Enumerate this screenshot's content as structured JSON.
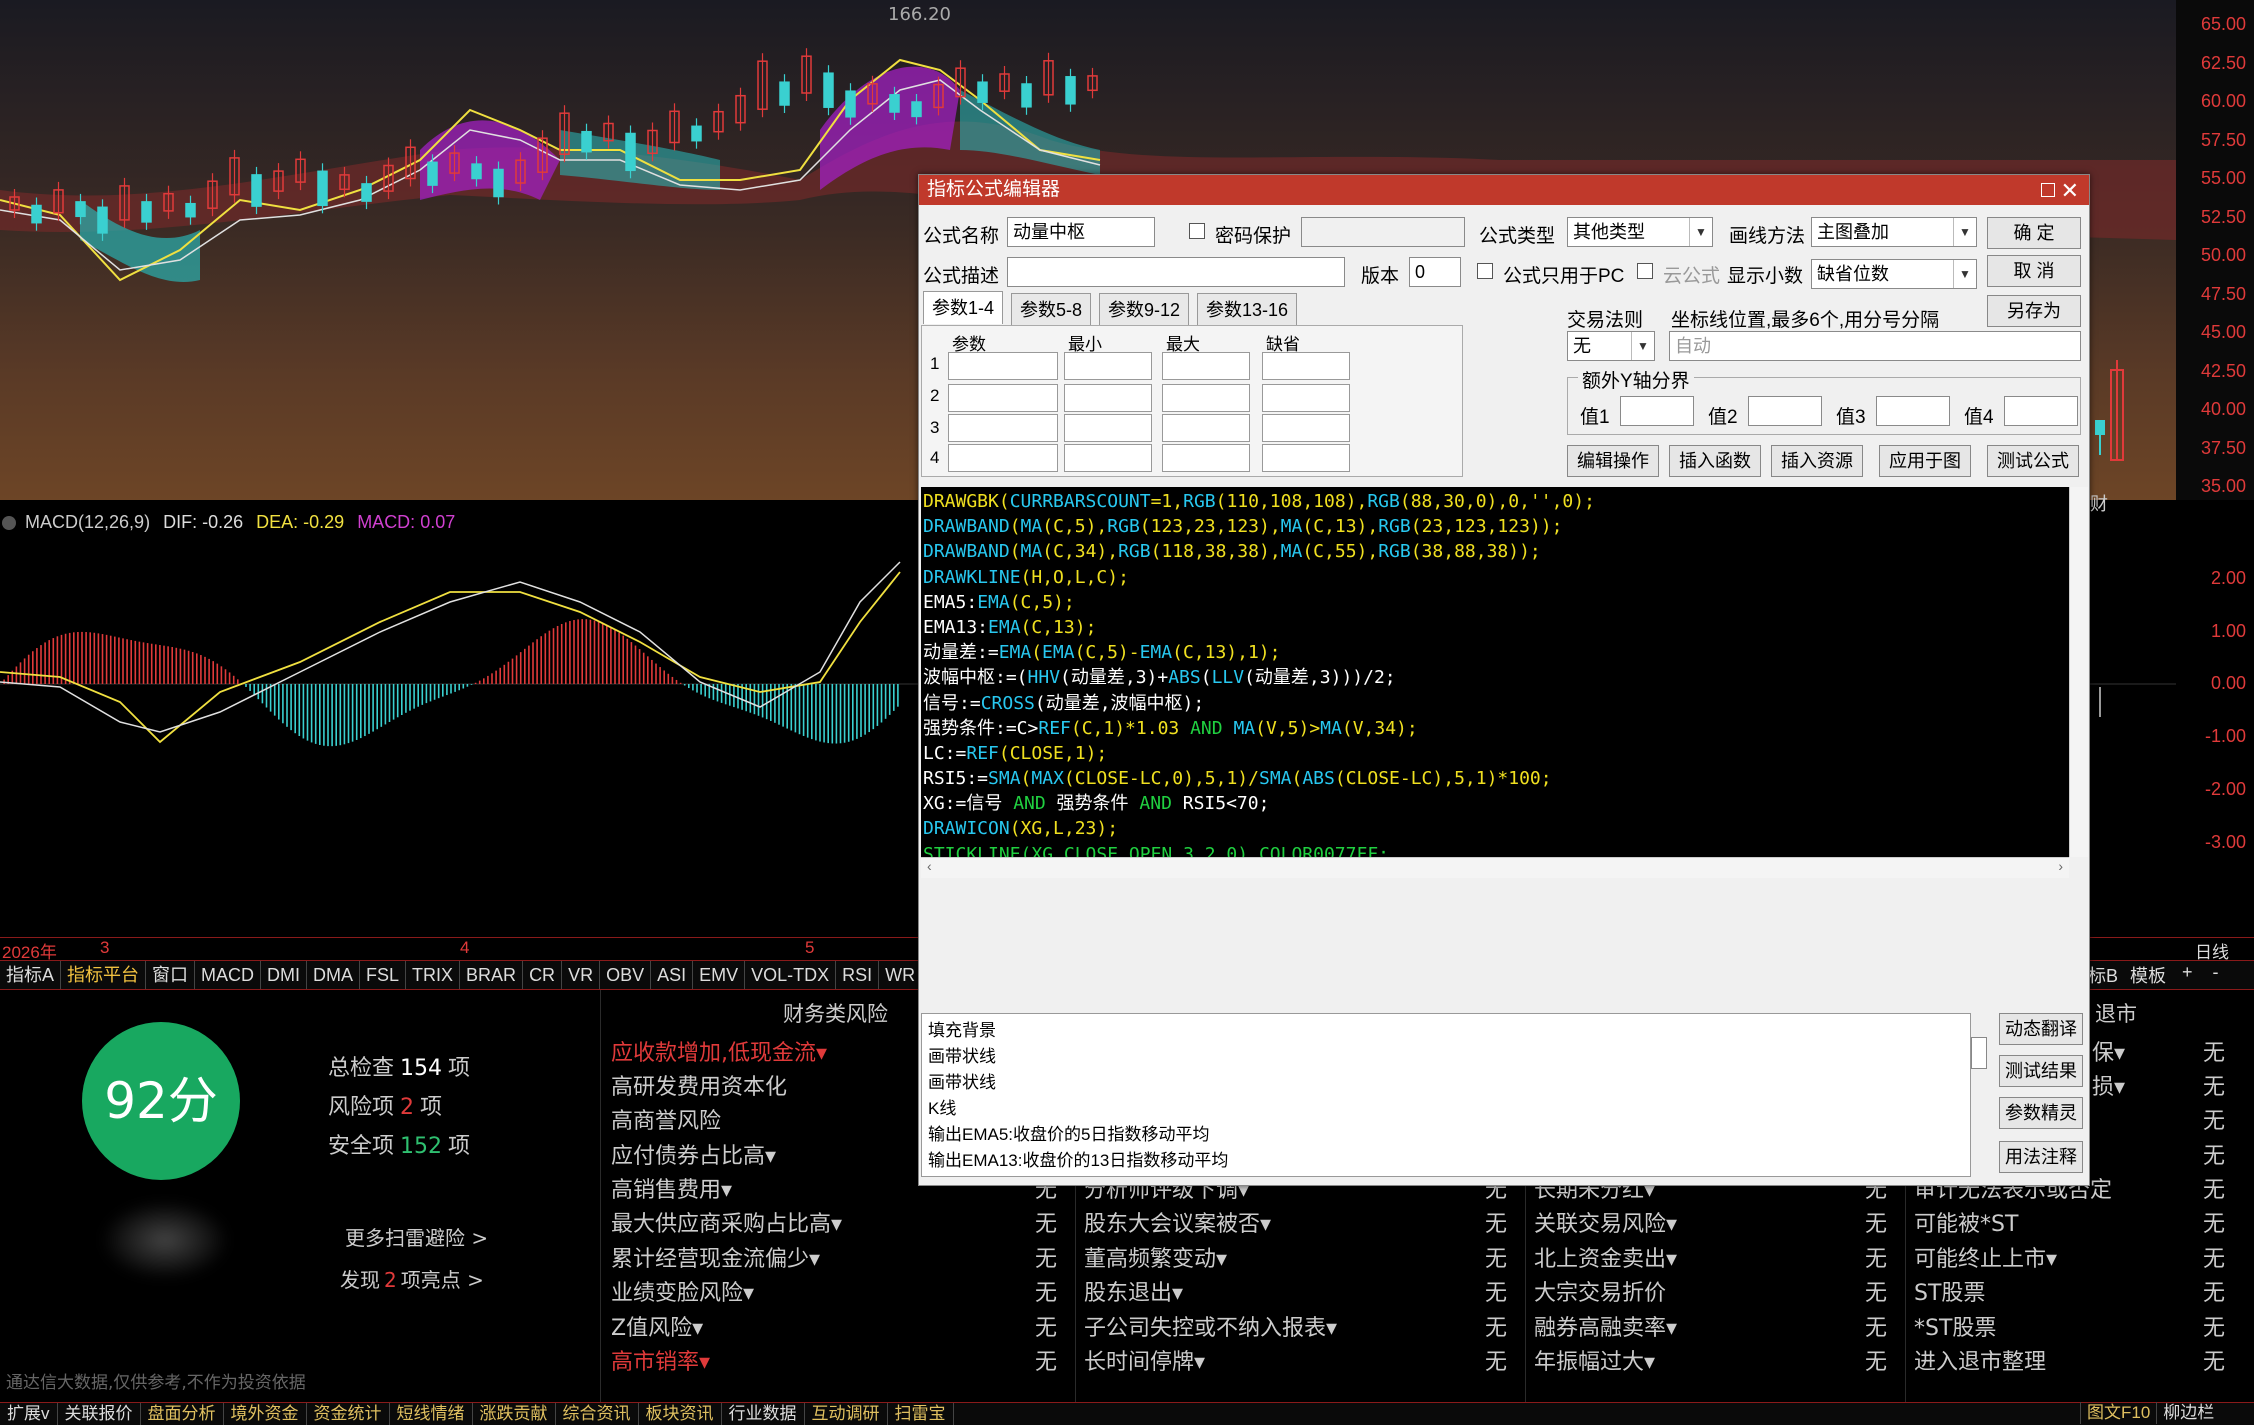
{
  "price_axis": [
    "65.00",
    "62.50",
    "60.00",
    "57.50",
    "55.00",
    "52.50",
    "50.00",
    "47.50",
    "45.00",
    "42.50",
    "40.00",
    "37.50",
    "35.00"
  ],
  "high_marker": "166.20",
  "macd": {
    "label": "MACD(12,26,9)",
    "dif": "DIF: -0.26",
    "dea": "DEA: -0.29",
    "macd": "MACD: 0.07",
    "axis": [
      "2.00",
      "1.00",
      "0.00",
      "-1.00",
      "-2.00",
      "-3.00"
    ],
    "right_label": "财"
  },
  "dates": {
    "year": "2026年",
    "m3": "3",
    "m4": "4",
    "m5": "5",
    "day": "日线"
  },
  "tabs": [
    "指标A",
    "指标平台",
    "窗口",
    "MACD",
    "DMI",
    "DMA",
    "FSL",
    "TRIX",
    "BRAR",
    "CR",
    "VR",
    "OBV",
    "ASI",
    "EMV",
    "VOL-TDX",
    "RSI",
    "WR"
  ],
  "tabs_right": [
    "标B",
    "模板",
    "+",
    "-"
  ],
  "risk": {
    "score": "92分",
    "total_label": "总检查",
    "total_value": "154",
    "total_unit": "项",
    "risk_label": "风险项",
    "risk_value": "2",
    "risk_unit": "项",
    "safe_label": "安全项",
    "safe_value": "152",
    "safe_unit": "项",
    "more_scan": "更多扫雷避险 >",
    "found_pre": "发现",
    "found_value": "2",
    "found_post": "项亮点 >",
    "disclaimer": "通达信大数据,仅供参考,不作为投资依据",
    "header_col1": "财务类风险",
    "header_col4": "退市",
    "col1": [
      "应收款增加,低现金流▾",
      "高研发费用资本化",
      "高商誉风险",
      "应付债券占比高▾",
      "高销售费用▾",
      "最大供应商采购占比高▾",
      "累计经营现金流偏少▾",
      "业绩变脸风险▾",
      "Z值风险▾",
      "高市销率▾"
    ],
    "col1_vals": [
      "无",
      "无",
      "无",
      "无",
      "无",
      "无",
      "〉"
    ],
    "col2": [
      "分析师评级下调▾",
      "股东大会议案被否▾",
      "董高频繁变动▾",
      "股东退出▾",
      "子公司失控或不纳入报表▾",
      "长时间停牌▾"
    ],
    "col2_vals": [
      "无",
      "无",
      "无",
      "无",
      "无",
      "无"
    ],
    "col3": [
      "长期未分红▾",
      "关联交易风险▾",
      "北上资金卖出▾",
      "大宗交易折价",
      "融券高融卖率▾",
      "年振幅过大▾"
    ],
    "col3_vals": [
      "无",
      "无",
      "无",
      "无",
      "无",
      "无"
    ],
    "col4": [
      "保▾",
      "损▾",
      "审计无法表示或否定",
      "可能被*ST",
      "可能终止上市▾",
      "ST股票",
      "*ST股票",
      "进入退市整理"
    ],
    "col4_vals": [
      "无",
      "无",
      "无",
      "无",
      "无",
      "无",
      "无",
      "无",
      "无",
      "无"
    ]
  },
  "bottom_tabs": [
    "扩展v",
    "关联报价",
    "盘面分析",
    "境外资金",
    "资金统计",
    "短线情绪",
    "涨跌贡献",
    "综合资讯",
    "板块资讯",
    "行业数据",
    "互动调研",
    "扫雷宝"
  ],
  "bottom_tabs_right": [
    "图文F10",
    "柳边栏"
  ],
  "dialog": {
    "title": "指标公式编辑器",
    "name_label": "公式名称",
    "name_value": "动量中枢",
    "pwd_label": "密码保护",
    "type_label": "公式类型",
    "type_value": "其他类型",
    "draw_label": "画线方法",
    "draw_value": "主图叠加",
    "ok": "确  定",
    "cancel": "取  消",
    "saveas": "另存为",
    "desc_label": "公式描述",
    "ver_label": "版本",
    "ver_value": "0",
    "pc_only": "公式只用于PC",
    "cloud": "云公式",
    "decimals_label": "显示小数",
    "decimals_value": "缺省位数",
    "param_tabs": [
      "参数1-4",
      "参数5-8",
      "参数9-12",
      "参数13-16"
    ],
    "param_headers": [
      "参数",
      "最小",
      "最大",
      "缺省"
    ],
    "param_rows": [
      "1",
      "2",
      "3",
      "4"
    ],
    "trade_rule_label": "交易法则",
    "trade_rule_value": "无",
    "coord_label": "坐标线位置,最多6个,用分号分隔",
    "coord_value": "自动",
    "yaxis_label": "额外Y轴分界",
    "v1": "值1",
    "v2": "值2",
    "v3": "值3",
    "v4": "值4",
    "btns": [
      "编辑操作",
      "插入函数",
      "插入资源",
      "应用于图",
      "测试公式"
    ],
    "side_btns": [
      "动态翻译",
      "测试结果",
      "参数精灵",
      "用法注释"
    ],
    "desc_lines": [
      "填充背景",
      "画带状线",
      "画带状线",
      "K线",
      "输出EMA5:收盘价的5日指数移动平均",
      "输出EMA13:收盘价的13日指数移动平均"
    ]
  },
  "code": [
    [
      [
        "y",
        "DRAWGBK("
      ],
      [
        "c",
        "CURRBARSCOUNT"
      ],
      [
        "y",
        "=1,"
      ],
      [
        "c",
        "RGB"
      ],
      [
        "y",
        "(110,108,108),"
      ],
      [
        "c",
        "RGB"
      ],
      [
        "y",
        "(88,30,0),0,'',0);"
      ]
    ],
    [
      [
        "c",
        "DRAWBAND"
      ],
      [
        "y",
        "("
      ],
      [
        "c",
        "MA"
      ],
      [
        "y",
        "(C,5),"
      ],
      [
        "c",
        "RGB"
      ],
      [
        "y",
        "(123,23,123),"
      ],
      [
        "c",
        "MA"
      ],
      [
        "y",
        "(C,13),"
      ],
      [
        "c",
        "RGB"
      ],
      [
        "y",
        "(23,123,123));"
      ]
    ],
    [
      [
        "c",
        "DRAWBAND"
      ],
      [
        "y",
        "("
      ],
      [
        "c",
        "MA"
      ],
      [
        "y",
        "(C,34),"
      ],
      [
        "c",
        "RGB"
      ],
      [
        "y",
        "(118,38,38),"
      ],
      [
        "c",
        "MA"
      ],
      [
        "y",
        "(C,55),"
      ],
      [
        "c",
        "RGB"
      ],
      [
        "y",
        "(38,88,38));"
      ]
    ],
    [
      [
        "c",
        "DRAWKLINE"
      ],
      [
        "y",
        "(H,O,L,C);"
      ]
    ],
    [
      [
        "w",
        "EMA5:"
      ],
      [
        "c",
        "EMA"
      ],
      [
        "y",
        "(C,5);"
      ]
    ],
    [
      [
        "w",
        "EMA13:"
      ],
      [
        "c",
        "EMA"
      ],
      [
        "y",
        "(C,13);"
      ]
    ],
    [
      [
        "w",
        "动量差:="
      ],
      [
        "c",
        "EMA"
      ],
      [
        "y",
        "("
      ],
      [
        "c",
        "EMA"
      ],
      [
        "y",
        "(C,5)-"
      ],
      [
        "c",
        "EMA"
      ],
      [
        "y",
        "(C,13),1);"
      ]
    ],
    [
      [
        "w",
        "波幅中枢:=("
      ],
      [
        "c",
        "HHV"
      ],
      [
        "w",
        "(动量差,3)+"
      ],
      [
        "c",
        "ABS"
      ],
      [
        "w",
        "("
      ],
      [
        "c",
        "LLV"
      ],
      [
        "w",
        "(动量差,3)))/2;"
      ]
    ],
    [
      [
        "w",
        "信号:="
      ],
      [
        "c",
        "CROSS"
      ],
      [
        "w",
        "(动量差,波幅中枢);"
      ]
    ],
    [
      [
        "w",
        "强势条件:=C>"
      ],
      [
        "c",
        "REF"
      ],
      [
        "y",
        "(C,1)*1.03 "
      ],
      [
        "g2",
        "AND"
      ],
      [
        "y",
        " "
      ],
      [
        "c",
        "MA"
      ],
      [
        "y",
        "(V,5)>"
      ],
      [
        "c",
        "MA"
      ],
      [
        "y",
        "(V,34);"
      ]
    ],
    [
      [
        "w",
        "LC:="
      ],
      [
        "c",
        "REF"
      ],
      [
        "y",
        "(CLOSE,1);"
      ]
    ],
    [
      [
        "w",
        "RSI5:="
      ],
      [
        "c",
        "SMA"
      ],
      [
        "y",
        "("
      ],
      [
        "c",
        "MAX"
      ],
      [
        "y",
        "(CLOSE-LC,0),5,1)/"
      ],
      [
        "c",
        "SMA"
      ],
      [
        "y",
        "("
      ],
      [
        "c",
        "ABS"
      ],
      [
        "y",
        "(CLOSE-LC),5,1)*100;"
      ]
    ],
    [
      [
        "w",
        "XG:=信号 "
      ],
      [
        "g2",
        "AND"
      ],
      [
        "w",
        " 强势条件 "
      ],
      [
        "g2",
        "AND"
      ],
      [
        "w",
        " RSI5<70;"
      ]
    ],
    [
      [
        "c",
        "DRAWICON"
      ],
      [
        "y",
        "(XG,L,23);"
      ]
    ],
    [
      [
        "g2",
        "STICKLINE(XG,CLOSE,OPEN,3.2,0),COLOR0077FF;"
      ]
    ],
    [
      [
        "g2",
        "STICKLINE(XG,CLOSE,OPEN,2.5,0),COLOR0099FF;"
      ]
    ],
    [
      [
        "g2",
        "STICKLINE(XG,CLOSE,OPEN,1.9,0),COLOR00BBFF;"
      ]
    ],
    [
      [
        "g2",
        "STICKLINE(XG,CLOSE,OPEN,1.2,0),COLOR00DDFF;"
      ]
    ],
    [
      [
        "g2",
        "STICKLINE(XG,CLOSE,OPEN,0.3,0),COLOR00FFFF;"
      ]
    ]
  ],
  "colors": {
    "up": "#e03a3a",
    "down": "#3ad0d0",
    "accent": "#c0392b",
    "safe": "#18a860"
  }
}
